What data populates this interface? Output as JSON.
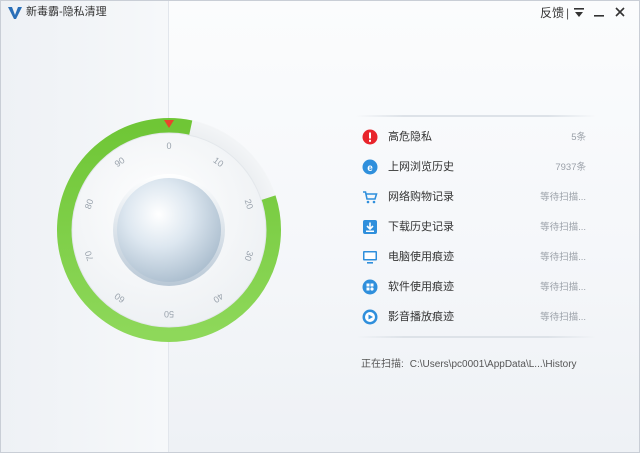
{
  "window": {
    "title": "新毒霸-隐私清理",
    "feedback_label": "反馈",
    "separator": "|"
  },
  "dial": {
    "ticks": [
      "0",
      "10",
      "20",
      "30",
      "40",
      "50",
      "60",
      "70",
      "80",
      "90"
    ],
    "progress_fraction": 0.03,
    "accent_color": "#6fc636",
    "pointer_color": "#e8452c"
  },
  "items": [
    {
      "label": "高危隐私",
      "status": "5条",
      "icon": "alert-icon",
      "color": "#e8242b"
    },
    {
      "label": "上网浏览历史",
      "status": "7937条",
      "icon": "browser-icon",
      "color": "#2f8fdc"
    },
    {
      "label": "网络购物记录",
      "status": "等待扫描...",
      "icon": "shopping-cart-icon",
      "color": "#2f8fdc"
    },
    {
      "label": "下载历史记录",
      "status": "等待扫描...",
      "icon": "download-icon",
      "color": "#2f8fdc"
    },
    {
      "label": "电脑使用痕迹",
      "status": "等待扫描...",
      "icon": "monitor-icon",
      "color": "#2f8fdc"
    },
    {
      "label": "软件使用痕迹",
      "status": "等待扫描...",
      "icon": "software-icon",
      "color": "#2f8fdc"
    },
    {
      "label": "影音播放痕迹",
      "status": "等待扫描...",
      "icon": "media-play-icon",
      "color": "#2f8fdc"
    }
  ],
  "scan": {
    "label": "正在扫描:",
    "path": "C:\\Users\\pc0001\\AppData\\L...\\History"
  }
}
